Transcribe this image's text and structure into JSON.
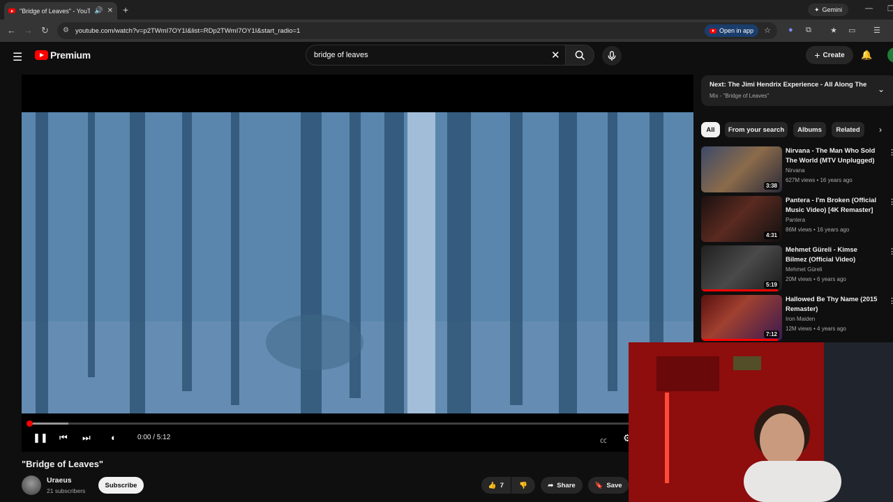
{
  "browser": {
    "tab_title": "\"Bridge of Leaves\" - YouTube",
    "url": "youtube.com/watch?v=p2TWmI7OY1I&list=RDp2TWmI7OY1I&start_radio=1",
    "gemini_label": "Gemini",
    "open_in_app_label": "Open in app"
  },
  "header": {
    "logo_text": "Premium",
    "search_value": "bridge of leaves",
    "create_label": "Create"
  },
  "player": {
    "time": "0:00 / 5:12",
    "progress": 0.0,
    "buffered": 0.06
  },
  "video": {
    "title": "\"Bridge of Leaves\"",
    "channel": "Uraeus",
    "subscribers": "21 subscribers",
    "subscribe_label": "Subscribe",
    "likes": "7",
    "share_label": "Share",
    "save_label": "Save"
  },
  "up_next": {
    "title": "Next: The Jimi Hendrix Experience - All Along The ...",
    "subtitle": "Mix - \"Bridge of Leaves\""
  },
  "chips": [
    "All",
    "From your search",
    "Albums",
    "Related"
  ],
  "recommendations": [
    {
      "title": "Nirvana - The Man Who Sold The World (MTV Unplugged)",
      "channel": "Nirvana",
      "meta": "627M views • 16 years ago",
      "duration": "3:38",
      "watched": 0
    },
    {
      "title": "Pantera - I'm Broken (Official Music Video) [4K Remaster]",
      "channel": "Pantera",
      "meta": "86M views • 16 years ago",
      "duration": "4:31",
      "watched": 0
    },
    {
      "title": "Mehmet Güreli - Kimse Bilmez (Official Video)",
      "channel": "Mehmet Güreli",
      "meta": "20M views • 6 years ago",
      "duration": "5:19",
      "watched": 0.95
    },
    {
      "title": "Hallowed Be Thy Name (2015 Remaster)",
      "channel": "Iron Maiden",
      "meta": "12M views • 4 years ago",
      "duration": "7:12",
      "watched": 0.95
    }
  ],
  "colors": {
    "accent": "#ff0000",
    "background": "#0f0f0f"
  }
}
